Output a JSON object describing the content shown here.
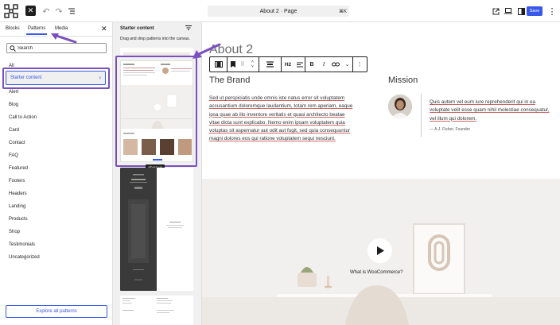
{
  "topbar": {
    "document_title": "About 2 · Page",
    "shortcut": "⌘K",
    "save_label": "Save"
  },
  "inserter": {
    "tabs": [
      {
        "label": "Blocks"
      },
      {
        "label": "Patterns"
      },
      {
        "label": "Media"
      }
    ],
    "search_placeholder": "Search",
    "categories": [
      "All",
      "Starter content",
      "Alert",
      "Blog",
      "Call to Action",
      "Card",
      "Contact",
      "FAQ",
      "Featured",
      "Footers",
      "Headers",
      "Landing",
      "Products",
      "Shop",
      "Testimonials",
      "Uncategorized"
    ],
    "active_category": "Starter content",
    "explore_label": "Explore all patterns"
  },
  "patterns_panel": {
    "title": "Starter content",
    "hint": "Drag and drop patterns into the canvas.",
    "tooltip": "About us"
  },
  "canvas": {
    "page_heading": "About 2",
    "toolbar_heading_level": "H2",
    "brand_heading": "The Brand",
    "brand_text_plain_1": "Sed ut perspiciatis unde omnis iste natus",
    "brand_text": "Sed ut perspiciatis unde omnis iste natus error sit voluptatem accusantium doloremque laudantium, totam rem aperiam, eaque ipsa quae ab illo inventore veritatis et quasi architecto beatae vitae dicta sunt explicabo. Nemo enim ipsam voluptatem quia voluptas sit aspernatur aut odit aut fugit, sed quia consequuntur magni dolores eos qui ratione voluptatem sequi nesciunt.",
    "mission_heading": "Mission",
    "quote": "Quis autem vel eum iure reprehenderit qui in ea voluptate velit esse quam nihil molestiae consequatur, vel illum qui dolorem.",
    "quote_cite": "— A.J. Fisher, Founder",
    "video_label": "What is WooCommerce?"
  },
  "colors": {
    "accent": "#3858e9",
    "highlight_outline": "#7a4fbf",
    "link_underline": "#cc6666"
  }
}
